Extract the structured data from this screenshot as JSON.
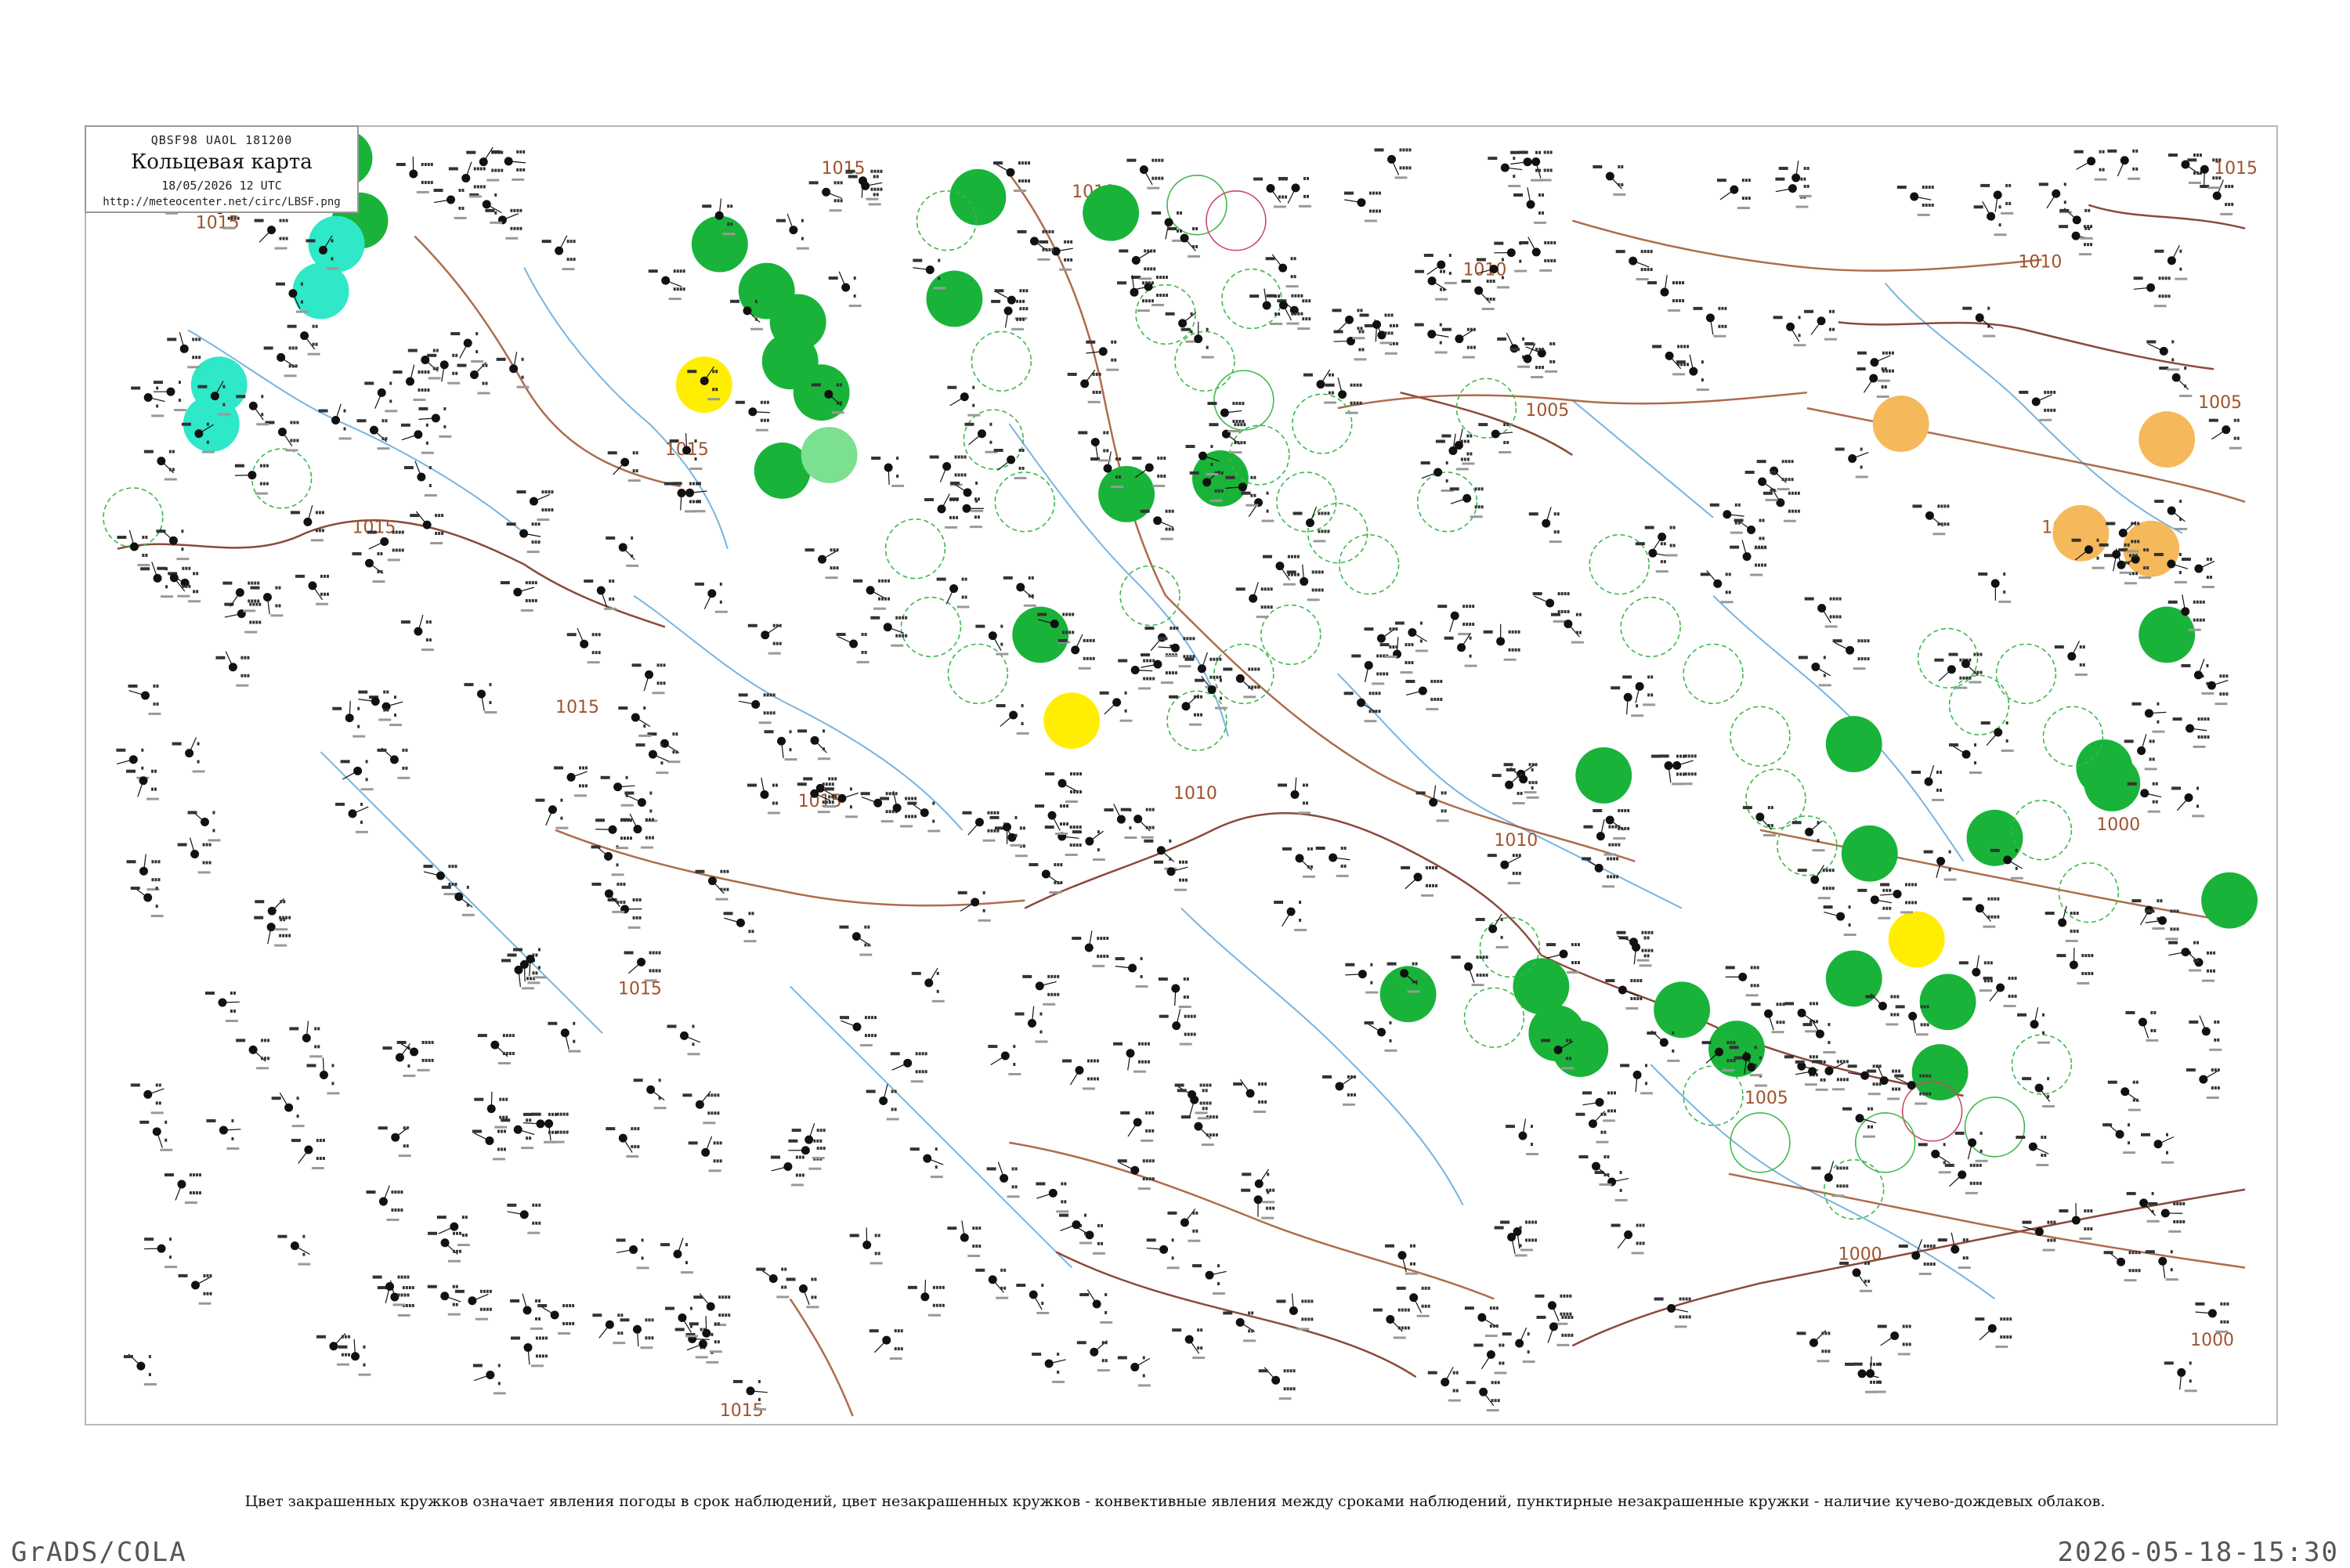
{
  "header": {
    "codes": "QBSF98  UAOL  181200",
    "title": "Кольцевая карта",
    "date": "18/05/2026 12 UTC",
    "url": "http://meteocenter.net/circ/LBSF.png"
  },
  "isobar_labels": [
    "1015",
    "1015",
    "1015",
    "1015",
    "1015",
    "1015",
    "1015",
    "1010",
    "1010",
    "1010",
    "1010",
    "1010",
    "1005",
    "1005",
    "1005",
    "1000",
    "1000",
    "1000",
    "1000",
    "1015",
    "1015"
  ],
  "legend_colors": {
    "rain": "#19b33a",
    "light_rain": "#7be08f",
    "fog_haze": "#ffee00",
    "dust": "#f5b85a",
    "snow_shower": "#2ee8c8",
    "other": "#b5b07a",
    "convective_outline": "#3cb84a",
    "thunder_outline": "#cc4466",
    "river": "#4a9bd6",
    "border": "#8b4a3a",
    "isobar": "#a0522d"
  },
  "caption": "Цвет закрашенных кружков означает явления погоды в срок наблюдений, цвет незакрашенных кружков - конвективные явления между сроками наблюдений, пунктирные незакрашенные кружки - наличие кучево-дождевых облаков.",
  "footer": {
    "left": "GrADS/COLA",
    "right": "2026-05-18-15:30"
  }
}
